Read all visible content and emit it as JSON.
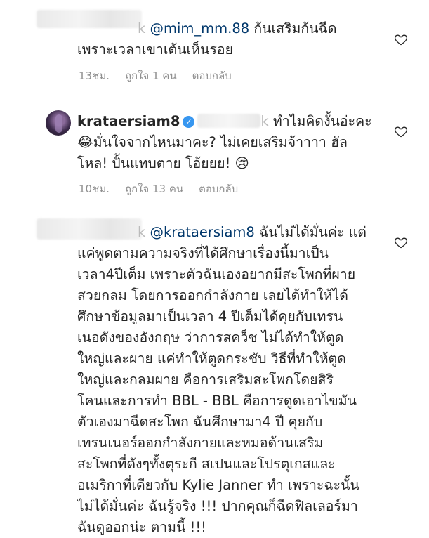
{
  "comments": [
    {
      "username_hint": "k",
      "mention": "@mim_mm.88",
      "body_line1": "ก้นเสริมก้นฉีด",
      "body_line2": "เพราะเวลาเขาเต้นเห็นรอย",
      "time": "13ชม.",
      "likes": "ถูกใจ 1 คน",
      "reply": "ตอบกลับ"
    },
    {
      "username": "krataersiam8",
      "name_hint": "k",
      "body_line1": "ทำไมคิดงั้นอ่ะคะ",
      "body_line2": "😂มั่นใจจากไหนมาคะ? ไม่เคยเสริมจ้าาาา ฮัล",
      "body_line3": "โหล! ปั้นแทบตาย โอ้ยยย! 😢",
      "time": "10ชม.",
      "likes": "ถูกใจ 13 คน",
      "reply": "ตอบกลับ"
    },
    {
      "username_hint": "k",
      "mention": "@krataersiam8",
      "lines": [
        "ฉันไม่ได้มั่นค่ะ แต่",
        "แค่พูดตามความจริงที่ได้ศึกษาเรื่องนี้มาเป็น",
        "เวลา4ปีเต็ม เพราะตัวฉันเองอยากมีสะโพกที่ผาย",
        "สวยกลม โดยการออกกำลังกาย เลยได้ทำให้ได้",
        "ศึกษาข้อมูลมาเป็นเวลา 4 ปีเต็มได้คุยกับเทรน",
        "เนอดังของอังกฤษ ว่าการสคว็ช ไม่ได้ทำให้ตูด",
        "ใหญ่และผาย แค่ทำให้ตูดกระชับ วิธีที่ทำให้ตูด",
        "ใหญ่และกลมผาย คือการเสริมสะโพกโดยสิริ",
        "โคนและการทำ BBL - BBL คือการดูดเอาไขมัน",
        "ตัวเองมาฉีดสะโพก ฉันศึกษามา4 ปี คุยกับ",
        "เทรนเนอร์ออกกำลังกายและหมอด้านเสริม",
        "สะโพกที่ดังๆทั้งตุระกี สเปนและโปรตุเกสและ",
        "อเมริกาที่เดียวกับ Kylie Janner ทำ เพราะฉะนั้น",
        "ไม่ได้มั่นค่ะ ฉันรู้จริง !!! ปากคุณก็ฉีดฟิลเลอร์มา",
        "ฉันดูออกน่ะ ตามนี้ !!!"
      ]
    }
  ]
}
